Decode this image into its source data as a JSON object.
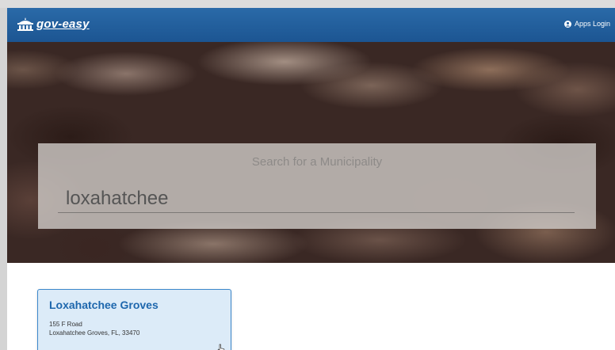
{
  "header": {
    "logo_text": "gov-easy",
    "apps_login": "Apps Login"
  },
  "search": {
    "title": "Search for a Municipality",
    "value": "loxahatchee"
  },
  "results": [
    {
      "name": "Loxahatchee Groves",
      "address_line1": "155 F Road",
      "address_line2": "Loxahatchee Groves, FL, 33470"
    }
  ],
  "colors": {
    "navbar": "#1f5a98",
    "accent": "#1e67ad",
    "card_bg": "#dcebf8",
    "card_border": "#3d88cc"
  },
  "icons": [
    "building-icon",
    "user-circle-icon",
    "hand-cursor-icon"
  ]
}
